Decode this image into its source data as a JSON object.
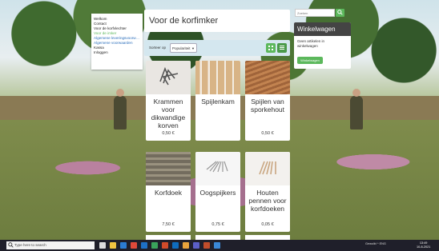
{
  "nav": {
    "items": [
      {
        "label": "Welkom",
        "state": "normal"
      },
      {
        "label": "Contact",
        "state": "normal"
      },
      {
        "label": "Voor de korfvlechter",
        "state": "normal"
      },
      {
        "label": "Voor de imker",
        "state": "active"
      },
      {
        "label": "Algemene leveringsvoorwaarden",
        "state": "link"
      },
      {
        "label": "Algemene voorwaarden",
        "state": "link"
      },
      {
        "label": "Kassa",
        "state": "normal"
      },
      {
        "label": "Inloggen",
        "state": "normal"
      }
    ]
  },
  "page": {
    "title": "Voor de korfimker"
  },
  "toolbar": {
    "sort_label": "Sorteer op",
    "sort_value": "Populariteit"
  },
  "products": [
    {
      "name": "Krammen voor dikwandige korven",
      "price": "0,50 €"
    },
    {
      "name": "Spijlenkam",
      "price": ""
    },
    {
      "name": "Spijlen van sporkehout",
      "price": "0,50 €"
    },
    {
      "name": "Korfdoek",
      "price": "7,50 €"
    },
    {
      "name": "Oogspijkers",
      "price": "0,75 €"
    },
    {
      "name": "Houten pennen voor korfdoeken",
      "price": "0,05 €"
    }
  ],
  "search": {
    "placeholder": "Zoeken"
  },
  "cart": {
    "title": "Winkelwagen",
    "empty_text": "Geen artikelen in winkelwagen",
    "button_label": "Winkelwagen"
  },
  "taskbar": {
    "search_placeholder": "Type here to search",
    "tray_text": "Gewolkt  ^  ENG",
    "clock_time": "13:49",
    "clock_date": "10-8-2021"
  },
  "colors": {
    "accent": "#5cb85c",
    "cart_header": "#444444",
    "toolbar": "#d4e7ef"
  }
}
